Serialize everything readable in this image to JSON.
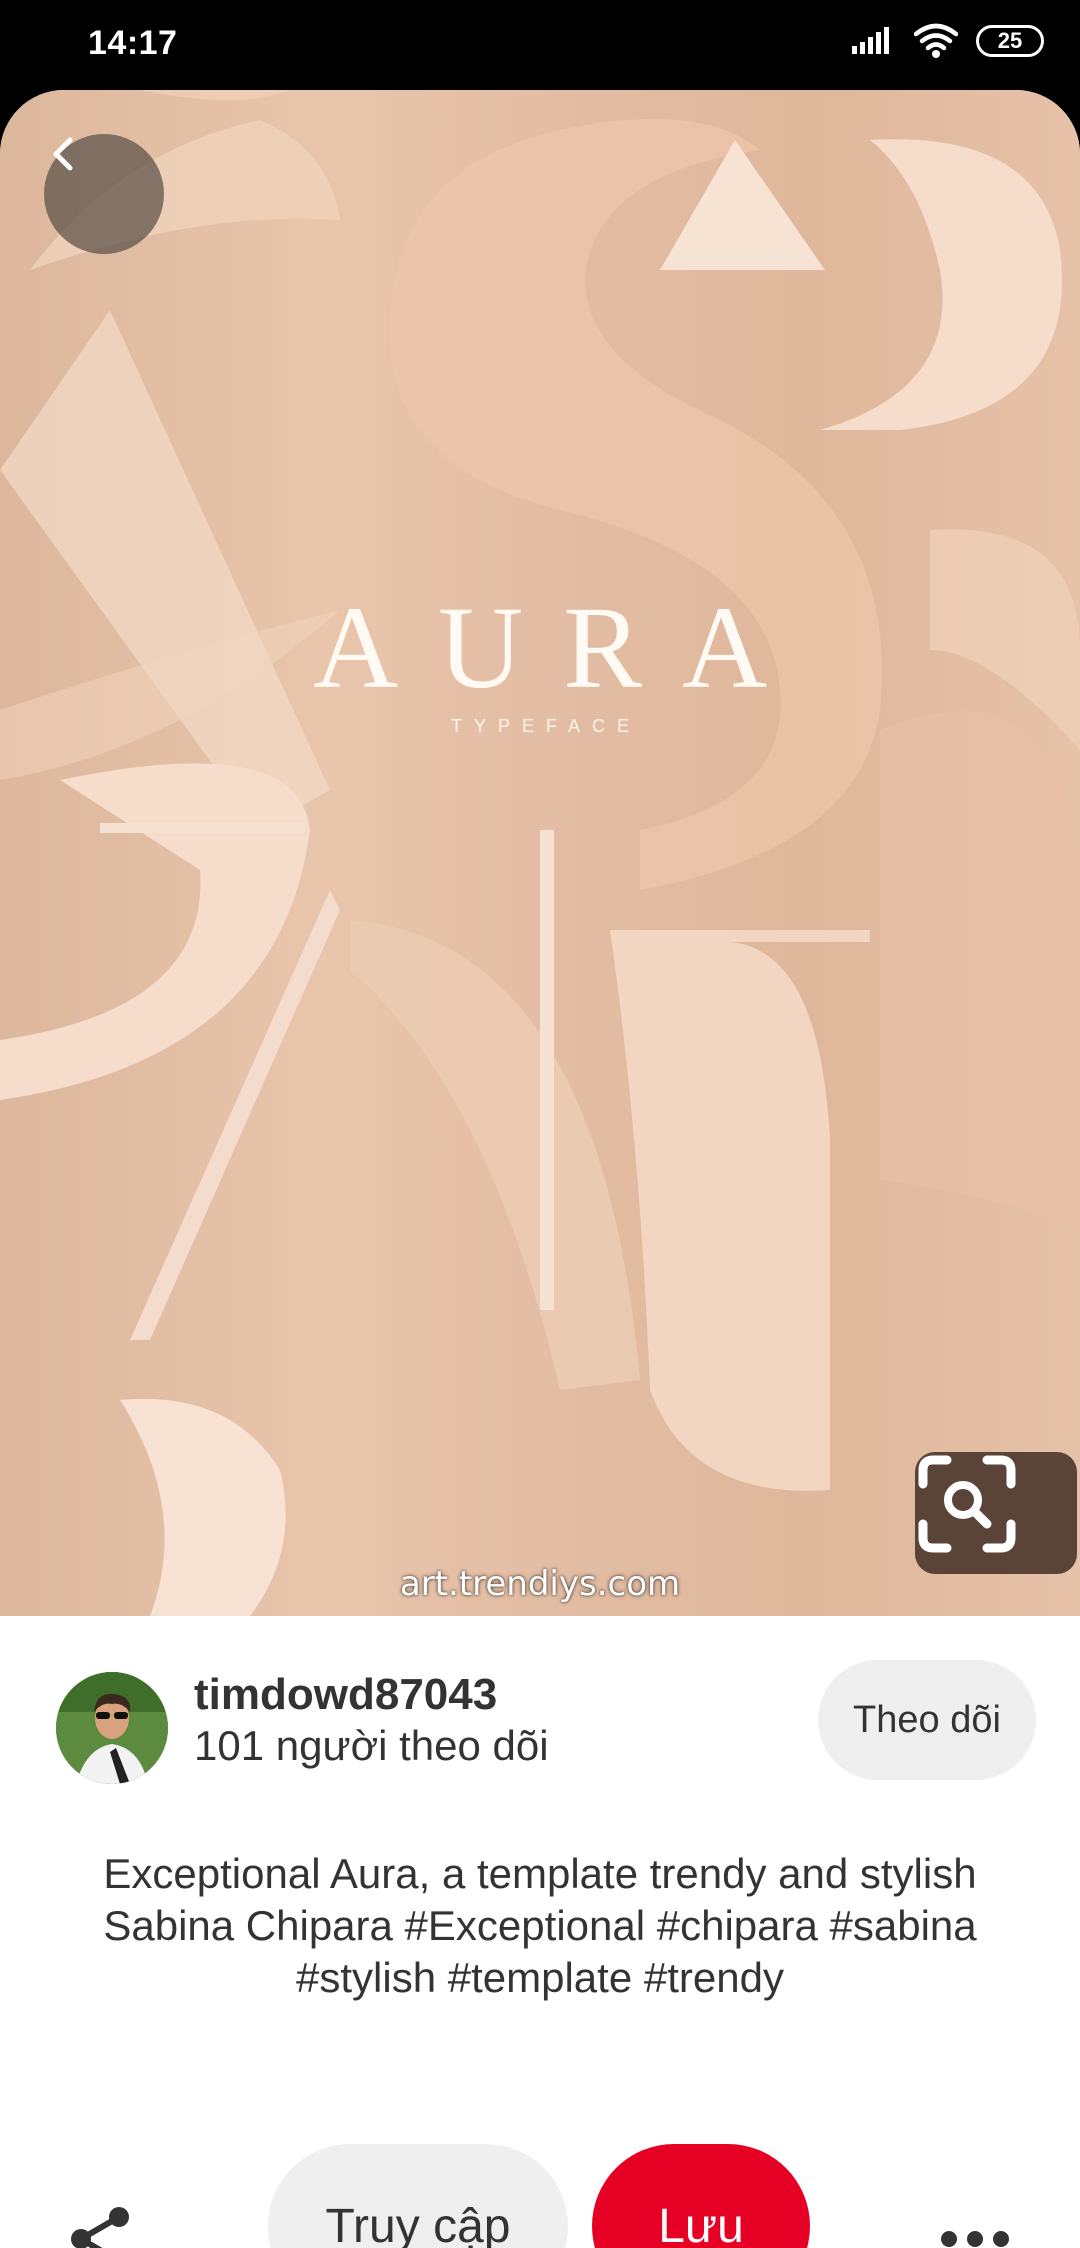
{
  "status_bar": {
    "time": "14:17",
    "battery": "25",
    "icons": [
      "signal-icon",
      "wifi-icon",
      "battery-icon"
    ]
  },
  "pin": {
    "image_title": "AURA",
    "image_subtitle": "TYPEFACE",
    "watermark": "art.trendiys.com",
    "icons": [
      "back-icon",
      "visual-search-icon"
    ]
  },
  "profile": {
    "username": "timdowd87043",
    "followers": "101 người theo dõi",
    "follow_label": "Theo dõi"
  },
  "description": "Exceptional Aura, a template trendy and stylish Sabina Chipara #Exceptional  #chipara #sabina #stylish #template #trendy",
  "actions": {
    "visit_label": "Truy cập",
    "save_label": "Lưu",
    "icons": [
      "share-icon",
      "more-icon"
    ]
  },
  "colors": {
    "save_button": "#e60023",
    "secondary_button": "#efefef",
    "image_background": "#e3bea3"
  }
}
